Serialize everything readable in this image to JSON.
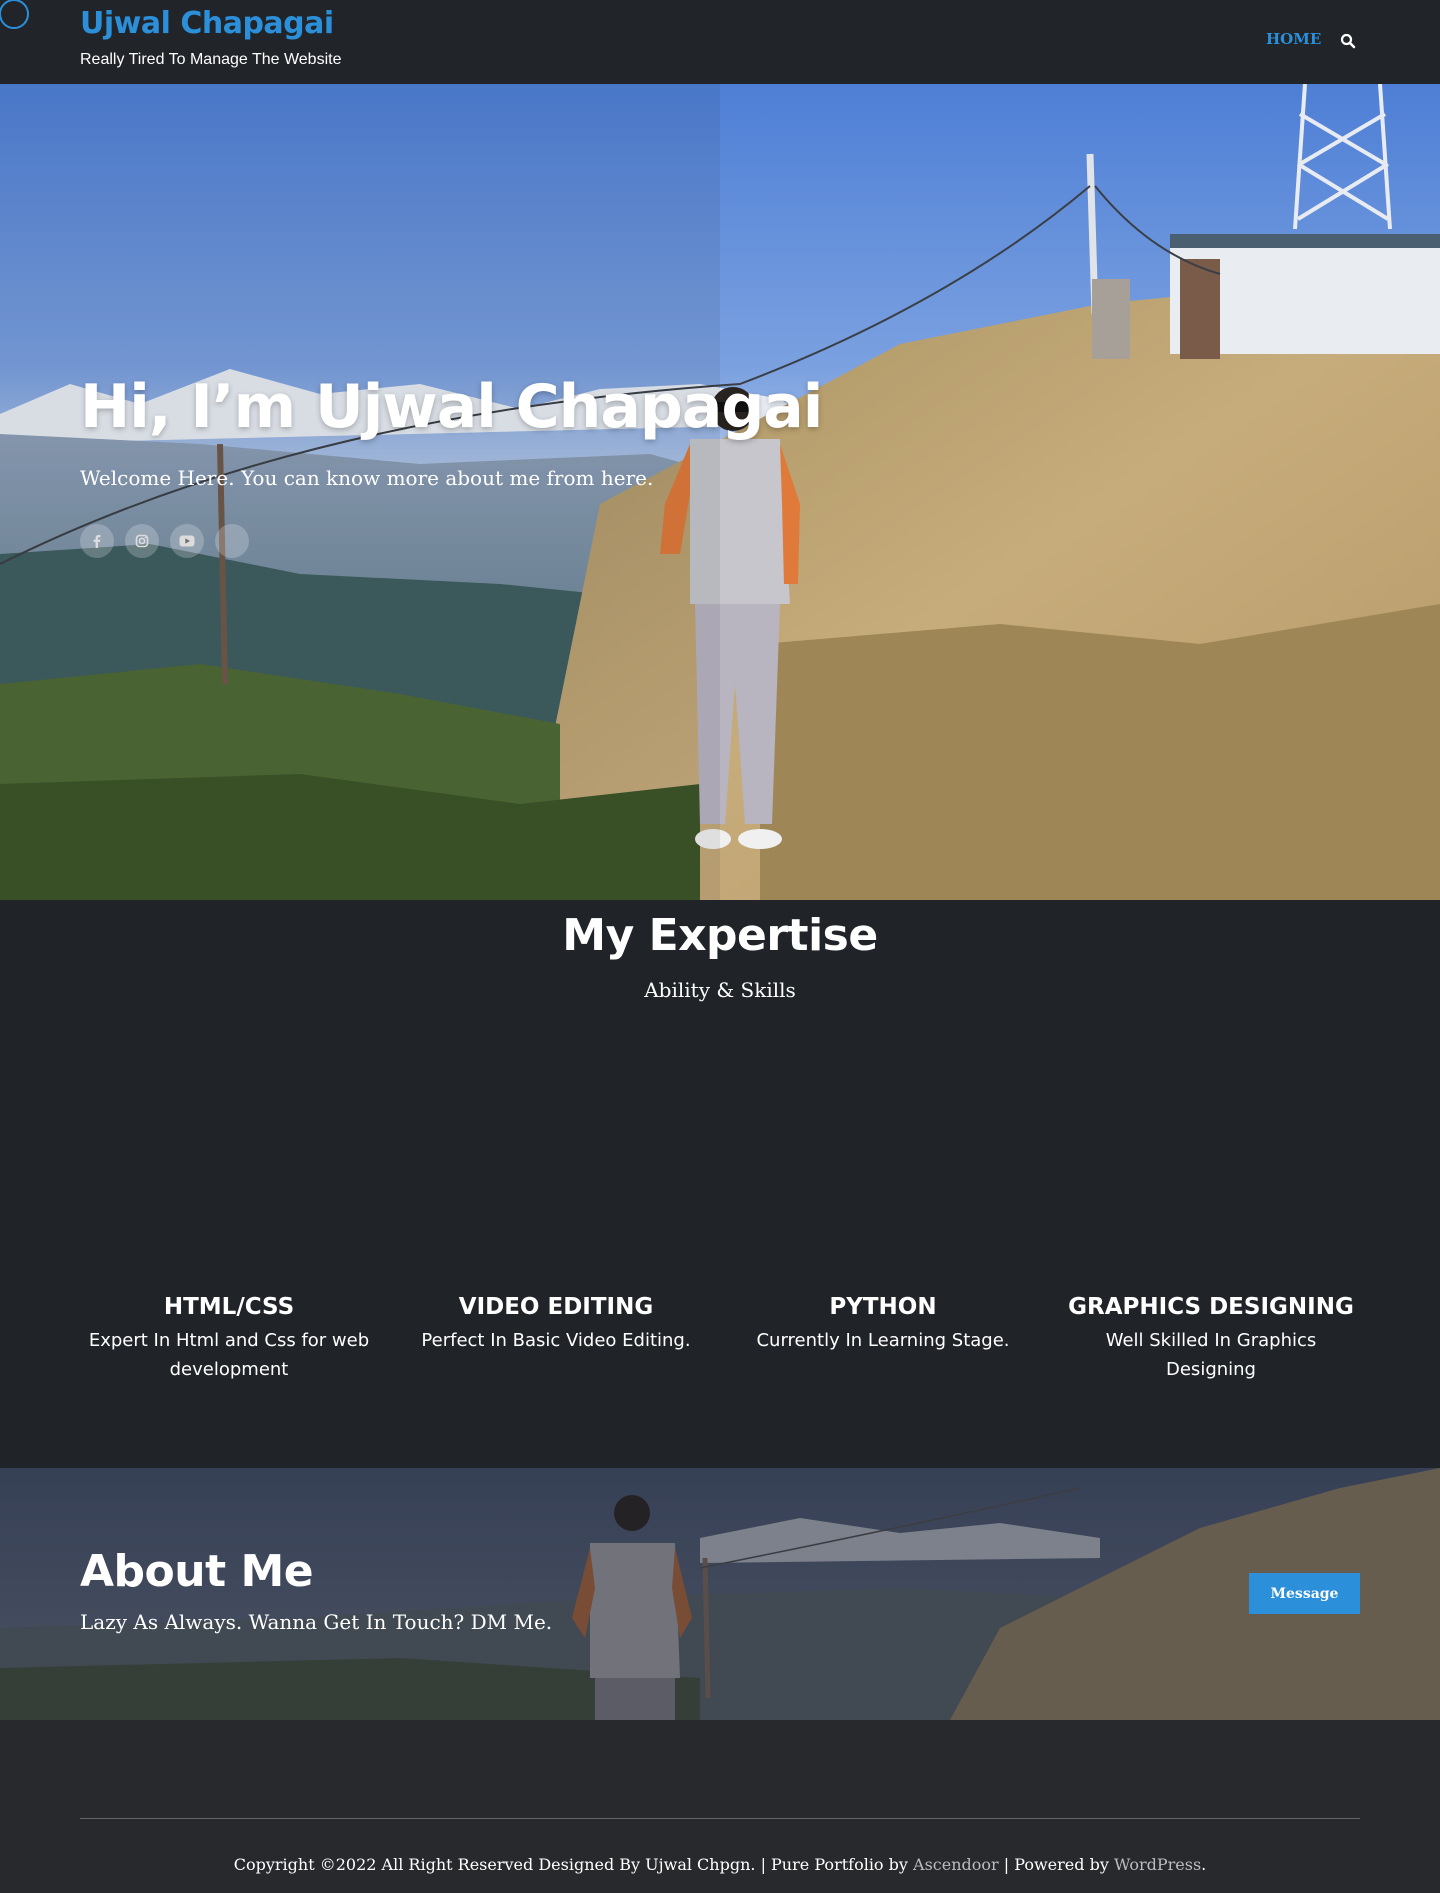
{
  "header": {
    "site_title": "Ujwal Chapagai",
    "tagline": "Really Tired To Manage The Website",
    "nav": [
      {
        "label": "HOME"
      }
    ],
    "search_icon": "search-icon"
  },
  "hero": {
    "title": "Hi, I’m Ujwal Chapagai",
    "subtitle": "Welcome Here. You can know more about me from here.",
    "social": [
      {
        "icon": "facebook-icon"
      },
      {
        "icon": "instagram-icon"
      },
      {
        "icon": "youtube-icon"
      },
      {
        "icon": "social-icon"
      }
    ]
  },
  "expertise": {
    "title": "My Expertise",
    "subtitle": "Ability & Skills",
    "skills": [
      {
        "title": "HTML/CSS",
        "desc": "Expert In Html and Css for web development"
      },
      {
        "title": "VIDEO EDITING",
        "desc": "Perfect In Basic Video Editing."
      },
      {
        "title": "PYTHON",
        "desc": "Currently In Learning Stage."
      },
      {
        "title": "GRAPHICS DESIGNING",
        "desc": "Well Skilled In Graphics Designing"
      }
    ]
  },
  "about": {
    "title": "About Me",
    "subtitle": "Lazy As Always. Wanna Get In Touch? DM Me.",
    "button_label": "Message"
  },
  "footer": {
    "copyright": "Copyright ©2022 All Right Reserved Designed By Ujwal Chpgn. | Pure Portfolio by ",
    "theme_link": "Ascendoor",
    "powered_prefix": " | Powered by ",
    "wp_link": "WordPress",
    "suffix": "."
  },
  "colors": {
    "accent": "#2b90d9",
    "background": "#202328",
    "footer_bg": "#27292d"
  }
}
